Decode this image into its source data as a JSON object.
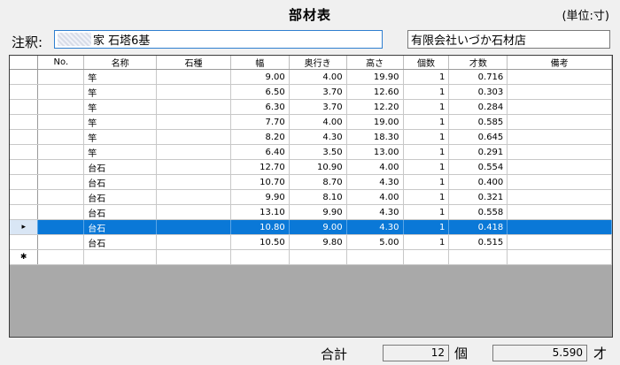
{
  "header": {
    "title": "部材表",
    "unit": "(単位:寸)"
  },
  "note": {
    "label": "注釈:",
    "value": "家 石塔6基"
  },
  "company": {
    "value": "有限会社いづか石材店"
  },
  "grid": {
    "columns": [
      "No.",
      "名称",
      "石種",
      "幅",
      "奥行き",
      "高さ",
      "個数",
      "才数",
      "備考"
    ],
    "rows": [
      {
        "no": "",
        "name": "竿",
        "stone": "",
        "width": "9.00",
        "depth": "4.00",
        "height": "19.90",
        "count": "1",
        "volume": "0.716",
        "remarks": ""
      },
      {
        "no": "",
        "name": "竿",
        "stone": "",
        "width": "6.50",
        "depth": "3.70",
        "height": "12.60",
        "count": "1",
        "volume": "0.303",
        "remarks": ""
      },
      {
        "no": "",
        "name": "竿",
        "stone": "",
        "width": "6.30",
        "depth": "3.70",
        "height": "12.20",
        "count": "1",
        "volume": "0.284",
        "remarks": ""
      },
      {
        "no": "",
        "name": "竿",
        "stone": "",
        "width": "7.70",
        "depth": "4.00",
        "height": "19.00",
        "count": "1",
        "volume": "0.585",
        "remarks": ""
      },
      {
        "no": "",
        "name": "竿",
        "stone": "",
        "width": "8.20",
        "depth": "4.30",
        "height": "18.30",
        "count": "1",
        "volume": "0.645",
        "remarks": ""
      },
      {
        "no": "",
        "name": "竿",
        "stone": "",
        "width": "6.40",
        "depth": "3.50",
        "height": "13.00",
        "count": "1",
        "volume": "0.291",
        "remarks": ""
      },
      {
        "no": "",
        "name": "台石",
        "stone": "",
        "width": "12.70",
        "depth": "10.90",
        "height": "4.00",
        "count": "1",
        "volume": "0.554",
        "remarks": ""
      },
      {
        "no": "",
        "name": "台石",
        "stone": "",
        "width": "10.70",
        "depth": "8.70",
        "height": "4.30",
        "count": "1",
        "volume": "0.400",
        "remarks": ""
      },
      {
        "no": "",
        "name": "台石",
        "stone": "",
        "width": "9.90",
        "depth": "8.10",
        "height": "4.00",
        "count": "1",
        "volume": "0.321",
        "remarks": ""
      },
      {
        "no": "",
        "name": "台石",
        "stone": "",
        "width": "13.10",
        "depth": "9.90",
        "height": "4.30",
        "count": "1",
        "volume": "0.558",
        "remarks": ""
      },
      {
        "no": "",
        "name": "台石",
        "stone": "",
        "width": "10.80",
        "depth": "9.00",
        "height": "4.30",
        "count": "1",
        "volume": "0.418",
        "remarks": "",
        "selected": true
      },
      {
        "no": "",
        "name": "台石",
        "stone": "",
        "width": "10.50",
        "depth": "9.80",
        "height": "5.00",
        "count": "1",
        "volume": "0.515",
        "remarks": ""
      }
    ],
    "current_row_marker": "▸",
    "new_row_marker": "✱",
    "selection_color": "#0a78d7"
  },
  "summary": {
    "label": "合計",
    "count": "12",
    "count_unit": "個",
    "volume": "5.590",
    "volume_unit": "才"
  }
}
